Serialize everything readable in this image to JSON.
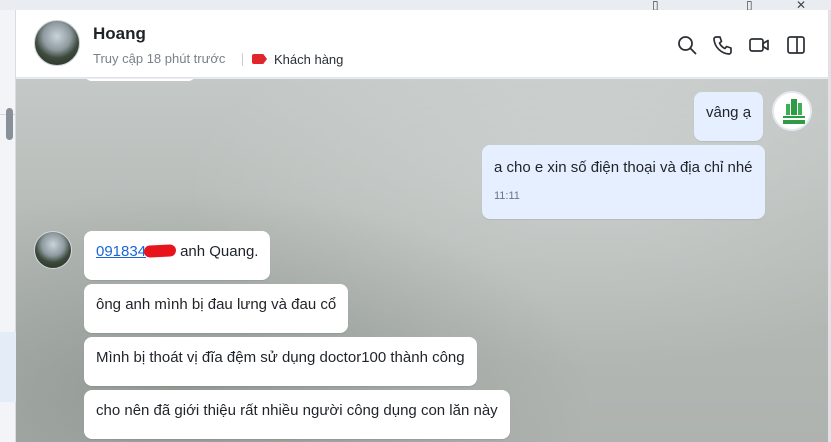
{
  "window": {
    "controls": [
      "minimize-icon",
      "maximize-icon",
      "close-icon"
    ]
  },
  "header": {
    "name": "Hoang",
    "status": "Truy cập 18 phút trước",
    "tag_label": "Khách hàng",
    "tag_color": "#e0262b",
    "actions": [
      "search-icon",
      "phone-icon",
      "video-icon",
      "sidebar-toggle-icon"
    ]
  },
  "messages": {
    "sent": [
      {
        "text": "vâng ạ"
      },
      {
        "text": "a cho e xin số điện thoại và địa chỉ nhé",
        "time": "11:11"
      }
    ],
    "received": [
      {
        "phone": "091834",
        "text": "anh Quang."
      },
      {
        "text": "ông anh mình bị đau lưng và đau cổ"
      },
      {
        "text": "Mình bị thoát vị đĩa đệm sử dụng doctor100 thành công"
      },
      {
        "text": "cho nên đã giới thiệu rất nhiều người công dụng con lăn này"
      }
    ]
  },
  "colors": {
    "sent_bubble": "#e5efff",
    "received_bubble": "#ffffff",
    "link": "#1a66d4"
  }
}
